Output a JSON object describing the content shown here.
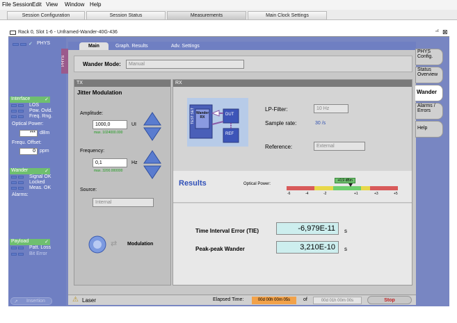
{
  "menu": [
    "File",
    "Session",
    "Edit",
    "View",
    "Window",
    "Help"
  ],
  "top_tabs": [
    "Session Configuration",
    "Session Status",
    "Measurements",
    "Main Clock Settings"
  ],
  "window_title": "Rack 0, Slot 1-6 - Unframed-Wander-40G-436",
  "left": {
    "phys_label": "PHYS",
    "interface_header": "Interface",
    "interface_items": [
      "LOS",
      "Pow. Ovld.",
      "Freq. Rng."
    ],
    "optical_power_label": "Optical Power:",
    "optical_power_value": "***",
    "optical_power_unit": "dBm",
    "freq_offset_label": "Frequ. Offset:",
    "freq_offset_value": "0",
    "freq_offset_unit": "ppm",
    "wander_header": "Wander",
    "wander_items": [
      "Signal OK",
      "Locked",
      "Meas. OK"
    ],
    "alarms_label": "Alarms:",
    "payload_header": "Payload",
    "payload_items": [
      "Patt. Loss",
      "Bit Error"
    ],
    "insertion_label": "Insertion"
  },
  "subtabs": [
    "Main",
    "Graph. Results",
    "Adv. Settings"
  ],
  "phys_vertical": "PHYS",
  "wander_mode_label": "Wander Mode:",
  "wander_mode_value": "Manual",
  "tx": {
    "header": "TX",
    "title": "Jitter Modulation",
    "amplitude_label": "Amplitude:",
    "amplitude_value": "1000,0",
    "amplitude_unit": "UI",
    "amplitude_max": "max. 1024000.000",
    "frequency_label": "Frequency:",
    "frequency_value": "0,1",
    "frequency_unit": "Hz",
    "frequency_max": "max. 3200.000000",
    "source_label": "Source:",
    "source_value": "Internal",
    "modulation_label": "Modulation"
  },
  "rx": {
    "header": "RX",
    "diagram": {
      "test_set": "TEST SET",
      "wander_rx": "Wander RX",
      "dut": "DUT",
      "ref": "REF"
    },
    "lp_filter_label": "LP-Filter:",
    "lp_filter_value": "10 Hz",
    "sample_rate_label": "Sample rate:",
    "sample_rate_value": "30 /s",
    "reference_label": "Reference:",
    "reference_value": "External"
  },
  "results": {
    "title": "Results",
    "optical_power_label": "Optical Power:",
    "optical_power_reading": "+0,9 dBm",
    "scale_ticks": [
      "-6",
      "-4",
      "-2",
      "+1",
      "+3",
      "+5"
    ],
    "optical_power_level": 0.9,
    "tie_label": "Time Interval Error (TIE)",
    "tie_value": "-6,979E-11",
    "tie_unit": "s",
    "ppw_label": "Peak-peak Wander",
    "ppw_value": "3,210E-10",
    "ppw_unit": "s"
  },
  "right_tabs": [
    "PHYS Config.",
    "Status Overview",
    "Wander",
    "Alarms / Errors",
    "Help"
  ],
  "status": {
    "laser_label": "Laser",
    "elapsed_label": "Elapsed Time:",
    "elapsed_value": "00d 00h 00m 05s",
    "of_label": "of",
    "total_value": "00d 01h 00m 00s",
    "stop_label": "Stop"
  },
  "colors": {
    "accent": "#6f7fc2",
    "green": "#6fbf6f",
    "value_bg": "#cdeeee"
  }
}
